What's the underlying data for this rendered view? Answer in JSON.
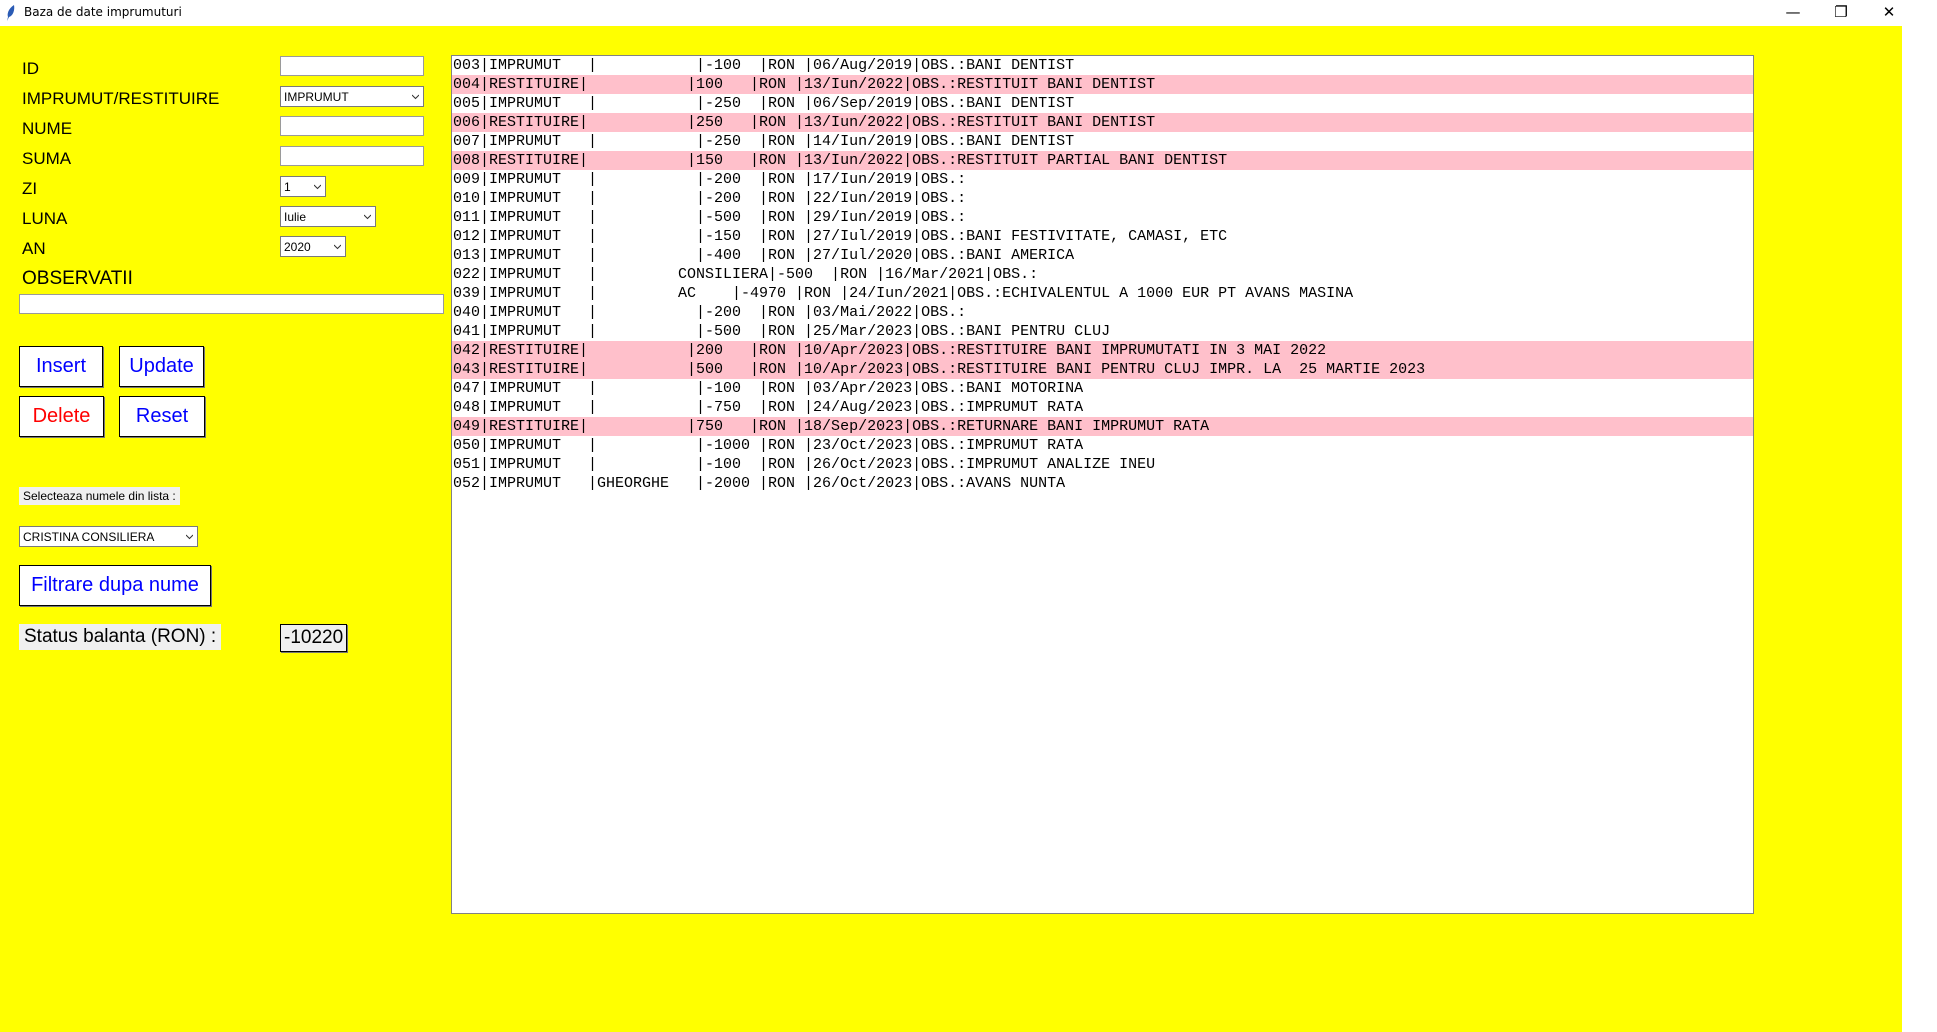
{
  "window": {
    "title": "Baza de date imprumuturi",
    "controls": {
      "minimize": "—",
      "restore": "❐",
      "close": "✕"
    }
  },
  "colors": {
    "background": "#ffff00",
    "restituire_row": "#ffc0cb",
    "button_text": "#0000ff",
    "delete_text": "#ff0000"
  },
  "form": {
    "id_label": "ID",
    "type_label": "IMPRUMUT/RESTITUIRE",
    "type_value": "IMPRUMUT",
    "name_label": "NUME",
    "sum_label": "SUMA",
    "day_label": "ZI",
    "day_value": "1",
    "month_label": "LUNA",
    "month_value": "Iulie",
    "year_label": "AN",
    "year_value": "2020",
    "obs_label": "OBSERVATII"
  },
  "buttons": {
    "insert": "Insert",
    "update": "Update",
    "delete": "Delete",
    "reset": "Reset",
    "filter": "Filtrare dupa nume"
  },
  "filter": {
    "label": "Selecteaza numele din lista :",
    "selected": "CRISTINA CONSILIERA"
  },
  "status": {
    "label": "Status balanta (RON) :",
    "value": "-10220"
  },
  "records": [
    {
      "text": "003|IMPRUMUT   |           |-100  |RON |06/Aug/2019|OBS.:BANI DENTIST",
      "kind": "imprumut"
    },
    {
      "text": "004|RESTITUIRE|           |100   |RON |13/Iun/2022|OBS.:RESTITUIT BANI DENTIST",
      "kind": "restituire"
    },
    {
      "text": "005|IMPRUMUT   |           |-250  |RON |06/Sep/2019|OBS.:BANI DENTIST",
      "kind": "imprumut"
    },
    {
      "text": "006|RESTITUIRE|           |250   |RON |13/Iun/2022|OBS.:RESTITUIT BANI DENTIST",
      "kind": "restituire"
    },
    {
      "text": "007|IMPRUMUT   |           |-250  |RON |14/Iun/2019|OBS.:BANI DENTIST",
      "kind": "imprumut"
    },
    {
      "text": "008|RESTITUIRE|           |150   |RON |13/Iun/2022|OBS.:RESTITUIT PARTIAL BANI DENTIST",
      "kind": "restituire"
    },
    {
      "text": "009|IMPRUMUT   |           |-200  |RON |17/Iun/2019|OBS.:",
      "kind": "imprumut"
    },
    {
      "text": "010|IMPRUMUT   |           |-200  |RON |22/Iun/2019|OBS.:",
      "kind": "imprumut"
    },
    {
      "text": "011|IMPRUMUT   |           |-500  |RON |29/Iun/2019|OBS.:",
      "kind": "imprumut"
    },
    {
      "text": "012|IMPRUMUT   |           |-150  |RON |27/Iul/2019|OBS.:BANI FESTIVITATE, CAMASI, ETC",
      "kind": "imprumut"
    },
    {
      "text": "013|IMPRUMUT   |           |-400  |RON |27/Iul/2020|OBS.:BANI AMERICA",
      "kind": "imprumut"
    },
    {
      "text": "022|IMPRUMUT   |         CONSILIERA|-500  |RON |16/Mar/2021|OBS.:",
      "kind": "imprumut"
    },
    {
      "text": "039|IMPRUMUT   |         AC    |-4970 |RON |24/Iun/2021|OBS.:ECHIVALENTUL A 1000 EUR PT AVANS MASINA",
      "kind": "imprumut"
    },
    {
      "text": "040|IMPRUMUT   |           |-200  |RON |03/Mai/2022|OBS.:",
      "kind": "imprumut"
    },
    {
      "text": "041|IMPRUMUT   |           |-500  |RON |25/Mar/2023|OBS.:BANI PENTRU CLUJ",
      "kind": "imprumut"
    },
    {
      "text": "042|RESTITUIRE|           |200   |RON |10/Apr/2023|OBS.:RESTITUIRE BANI IMPRUMUTATI IN 3 MAI 2022",
      "kind": "restituire"
    },
    {
      "text": "043|RESTITUIRE|           |500   |RON |10/Apr/2023|OBS.:RESTITUIRE BANI PENTRU CLUJ IMPR. LA  25 MARTIE 2023",
      "kind": "restituire"
    },
    {
      "text": "047|IMPRUMUT   |           |-100  |RON |03/Apr/2023|OBS.:BANI MOTORINA",
      "kind": "imprumut"
    },
    {
      "text": "048|IMPRUMUT   |           |-750  |RON |24/Aug/2023|OBS.:IMPRUMUT RATA",
      "kind": "imprumut"
    },
    {
      "text": "049|RESTITUIRE|           |750   |RON |18/Sep/2023|OBS.:RETURNARE BANI IMPRUMUT RATA",
      "kind": "restituire"
    },
    {
      "text": "050|IMPRUMUT   |           |-1000 |RON |23/Oct/2023|OBS.:IMPRUMUT RATA",
      "kind": "imprumut"
    },
    {
      "text": "051|IMPRUMUT   |           |-100  |RON |26/Oct/2023|OBS.:IMPRUMUT ANALIZE INEU",
      "kind": "imprumut"
    },
    {
      "text": "052|IMPRUMUT   |GHEORGHE   |-2000 |RON |26/Oct/2023|OBS.:AVANS NUNTA",
      "kind": "imprumut"
    }
  ]
}
